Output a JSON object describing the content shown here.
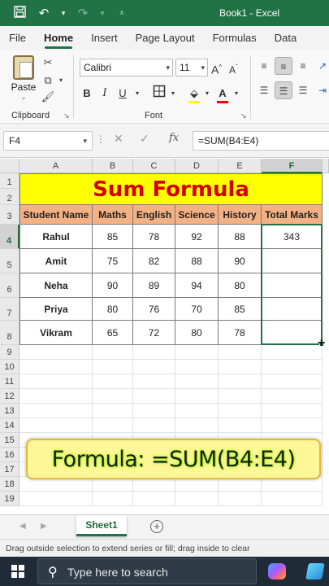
{
  "titlebar": {
    "document_title": "Book1  -  Excel",
    "icons": [
      "save-icon",
      "undo-icon",
      "redo-icon",
      "customize-qat-icon"
    ]
  },
  "ribbon_tabs": [
    "File",
    "Home",
    "Insert",
    "Page Layout",
    "Formulas",
    "Data"
  ],
  "ribbon": {
    "paste_label": "Paste",
    "clipboard_label": "Clipboard",
    "font_label": "Font",
    "font_name": "Calibri",
    "font_size": "11",
    "bold": "B",
    "italic": "I",
    "underline": "U",
    "grow": "A",
    "shrink": "A"
  },
  "formula_bar": {
    "name_box": "F4",
    "formula": "=SUM(B4:E4)",
    "fx": "fx"
  },
  "columns": [
    "A",
    "B",
    "C",
    "D",
    "E",
    "F"
  ],
  "rows": [
    "1",
    "2",
    "3",
    "4",
    "5",
    "6",
    "7",
    "8",
    "9",
    "10",
    "11",
    "12",
    "13",
    "14",
    "15",
    "16",
    "17",
    "18",
    "19"
  ],
  "sheet": {
    "title": "Sum Formula",
    "headers": [
      "Student Name",
      "Maths",
      "English",
      "Science",
      "History",
      "Total Marks"
    ],
    "students": [
      {
        "name": "Rahul",
        "maths": "85",
        "english": "78",
        "science": "92",
        "history": "88",
        "total": "343"
      },
      {
        "name": "Amit",
        "maths": "75",
        "english": "82",
        "science": "88",
        "history": "90",
        "total": ""
      },
      {
        "name": "Neha",
        "maths": "90",
        "english": "89",
        "science": "94",
        "history": "80",
        "total": ""
      },
      {
        "name": "Priya",
        "maths": "80",
        "english": "76",
        "science": "70",
        "history": "85",
        "total": ""
      },
      {
        "name": "Vikram",
        "maths": "65",
        "english": "72",
        "science": "80",
        "history": "78",
        "total": ""
      }
    ]
  },
  "overlay_text": "Formula: =SUM(B4:E4)",
  "sheet_tabs": [
    "Sheet1"
  ],
  "status_text": "Drag outside selection to extend series or fill; drag inside to clear",
  "taskbar": {
    "search_placeholder": "Type here to search"
  },
  "colors": {
    "excel_green": "#217346",
    "title_fill": "#ffff00",
    "title_text": "#d40000",
    "header_fill": "#f4b183"
  }
}
